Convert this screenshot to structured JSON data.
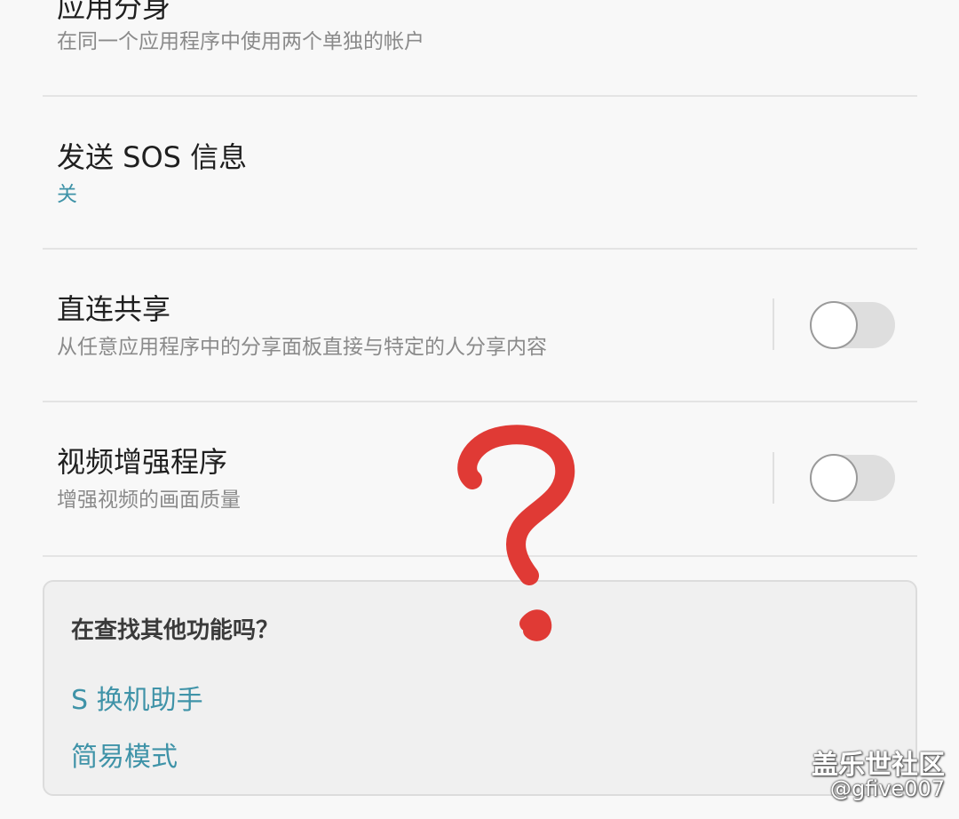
{
  "settings": {
    "items": [
      {
        "title": "应用分身",
        "subtitle": "在同一个应用程序中使用两个单独的帐户"
      },
      {
        "title": "发送 SOS 信息",
        "subtitle": "关"
      },
      {
        "title": "直连共享",
        "subtitle": "从任意应用程序中的分享面板直接与特定的人分享内容",
        "toggle": "off"
      },
      {
        "title": "视频增强程序",
        "subtitle": "增强视频的画面质量",
        "toggle": "off"
      }
    ]
  },
  "suggestion_card": {
    "title": "在查找其他功能吗？",
    "links": [
      "S 换机助手",
      "简易模式"
    ]
  },
  "annotation": {
    "type": "hand-drawn-question-mark",
    "color": "#e03a35"
  },
  "watermark": {
    "line1": "盖乐世社区",
    "line2": "@gfive007"
  },
  "colors": {
    "background": "#f8f8f8",
    "accent": "#3f93a8",
    "annotation": "#e03a35"
  }
}
